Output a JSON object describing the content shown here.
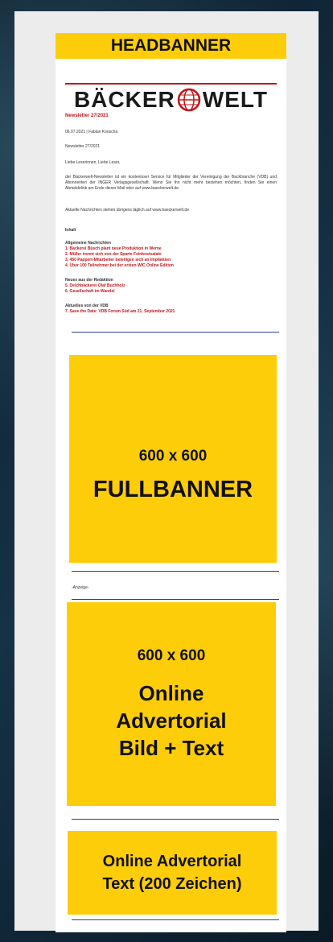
{
  "headbanner": {
    "label": "HEADBANNER"
  },
  "logo": {
    "left_text": "BÄCKER",
    "right_text": "WELT"
  },
  "newsletter": {
    "title": "Newsletter 27/2021",
    "byline": "06.07.2021 | Fabian Konscha",
    "subtitle": "Newsletter 27/2021",
    "greeting": "Liebe Leserinnen, Liebe Leser,",
    "intro": "der Bäckerwelt-Newsletter ist ein kostenloser Service für Mitglieder der Vereinigung der Backbranche (VDB) und Abonnenten der INGER Verlagsgesellschaft. Wenn Sie ihn nicht mehr beziehen möchten, finden Sie einen Abmeldelink am Ende dieser Mail oder auf www.baeckerwelt.de.",
    "news_line": "Aktuelle Nachrichten stehen übrigens täglich auf www.baeckerwelt.de",
    "toc_title": "Inhalt",
    "sections": [
      {
        "heading": "Allgemeine Nachrichten",
        "items": [
          "1. Bäckerei Büsch plant neue Produktion in Werne",
          "2. Müller trennt sich von der Sparte Feinkostsalate",
          "3. 450 Pappert-Mitarbeiter beteiligen sich an Impfaktion",
          "4. Über 100 Teilnehmer bei der ersten WIC Online Edition"
        ]
      },
      {
        "heading": "Neues aus der Redaktion",
        "items": [
          "5. Deichbäckerei Olaf Buchholz",
          "6. Gesellschaft im Wandel"
        ]
      },
      {
        "heading": "Aktuelles von der VDB",
        "items": [
          "7. Save the Date: VDB Forum Süd am 21. September 2021"
        ]
      }
    ]
  },
  "fullbanner": {
    "size": "600 x 600",
    "label": "FULLBANNER"
  },
  "anzeige": {
    "label": "-Anzeige-"
  },
  "advertorial": {
    "size": "600 x 600",
    "label_line1": "Online",
    "label_line2": "Advertorial",
    "label_line3": "Bild + Text"
  },
  "text_advertorial": {
    "line1": "Online Advertorial",
    "line2": "Text (200 Zeichen)"
  },
  "colors": {
    "accent": "#fecd0a",
    "brand_red": "#c0161b",
    "divider": "#2b3f8c"
  }
}
